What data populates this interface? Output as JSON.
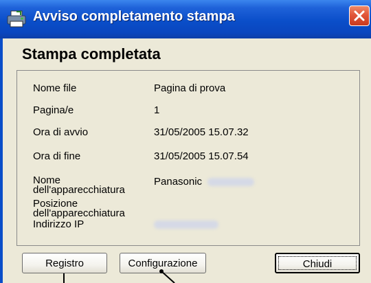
{
  "window": {
    "title": "Avviso completamento stampa",
    "icons": {
      "app": "printer-icon",
      "close": "close-icon"
    }
  },
  "heading": "Stampa completata",
  "details": {
    "file_name": {
      "label": "Nome file",
      "value": "Pagina di prova"
    },
    "pages": {
      "label": "Pagina/e",
      "value": "1"
    },
    "start_time": {
      "label": "Ora di avvio",
      "value": "31/05/2005 15.07.32"
    },
    "end_time": {
      "label": "Ora di fine",
      "value": "31/05/2005 15.07.54"
    },
    "device_name": {
      "label_line1": "Nome",
      "label_line2": "dell'apparecchiatura",
      "value": "Panasonic"
    },
    "location": {
      "label_line1": "Posizione",
      "label_line2": "dell'apparecchiatura"
    },
    "ip_address": {
      "label": "Indirizzo IP"
    }
  },
  "buttons": {
    "log": "Registro",
    "configuration": "Configurazione",
    "close": "Chiudi"
  },
  "colors": {
    "titlebar": "#0a4ec9",
    "close_button": "#e2563a",
    "dialog_bg": "#ece9d8"
  }
}
